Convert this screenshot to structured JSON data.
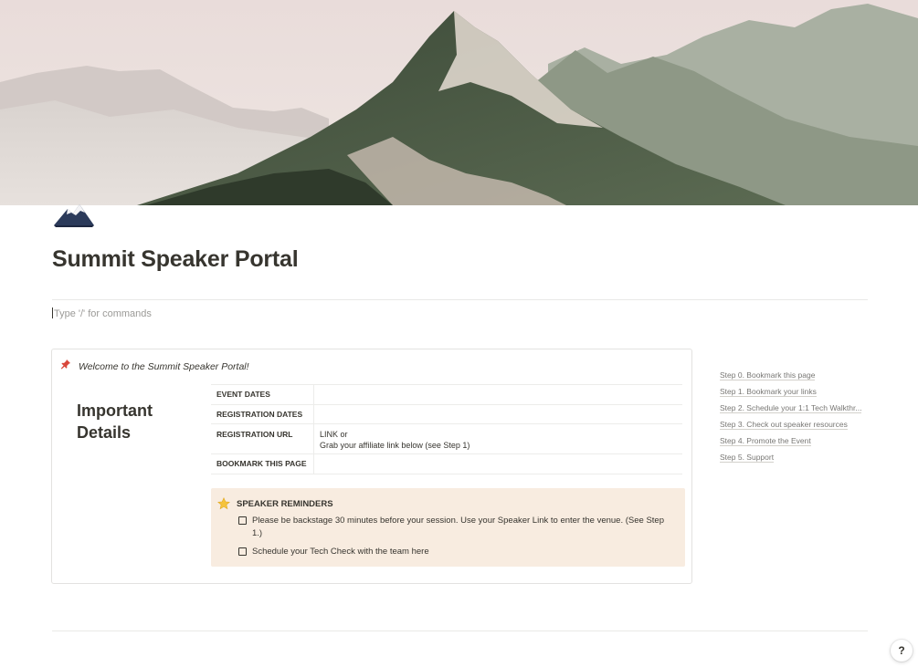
{
  "cover": {
    "name": "mountain-cover-image"
  },
  "page": {
    "icon": "mountain-icon",
    "title": "Summit Speaker Portal",
    "placeholder": "Type '/' for commands"
  },
  "callout": {
    "icon": "pushpin-icon",
    "welcome": "Welcome to the Summit Speaker Portal!",
    "heading": "Important Details",
    "table": [
      {
        "key": "EVENT DATES",
        "value": ""
      },
      {
        "key": "REGISTRATION DATES",
        "value": ""
      },
      {
        "key": "REGISTRATION URL",
        "value_line1": "LINK or",
        "value_line2": "Grab your affiliate link below (see Step 1)"
      },
      {
        "key": "BOOKMARK THIS PAGE",
        "value": ""
      }
    ],
    "reminders": {
      "icon": "star-icon",
      "title": "SPEAKER REMINDERS",
      "items": [
        {
          "label": "Please be backstage 30 minutes before your session. Use your Speaker Link to enter the venue. (See Step 1.)",
          "checked": false
        },
        {
          "label": "Schedule your Tech Check with the team here",
          "checked": false
        }
      ]
    }
  },
  "toc": [
    "Step 0. Bookmark this page",
    "Step 1. Bookmark your links",
    "Step 2. Schedule your 1:1 Tech Walkthr...",
    "Step 3. Check out speaker resources",
    "Step 4. Promote the Event",
    "Step 5. Support"
  ],
  "help": {
    "label": "?"
  },
  "colors": {
    "text": "#37352f",
    "muted": "#787774",
    "reminder_bg": "#f8ece0",
    "border": "#e3e2e0"
  }
}
